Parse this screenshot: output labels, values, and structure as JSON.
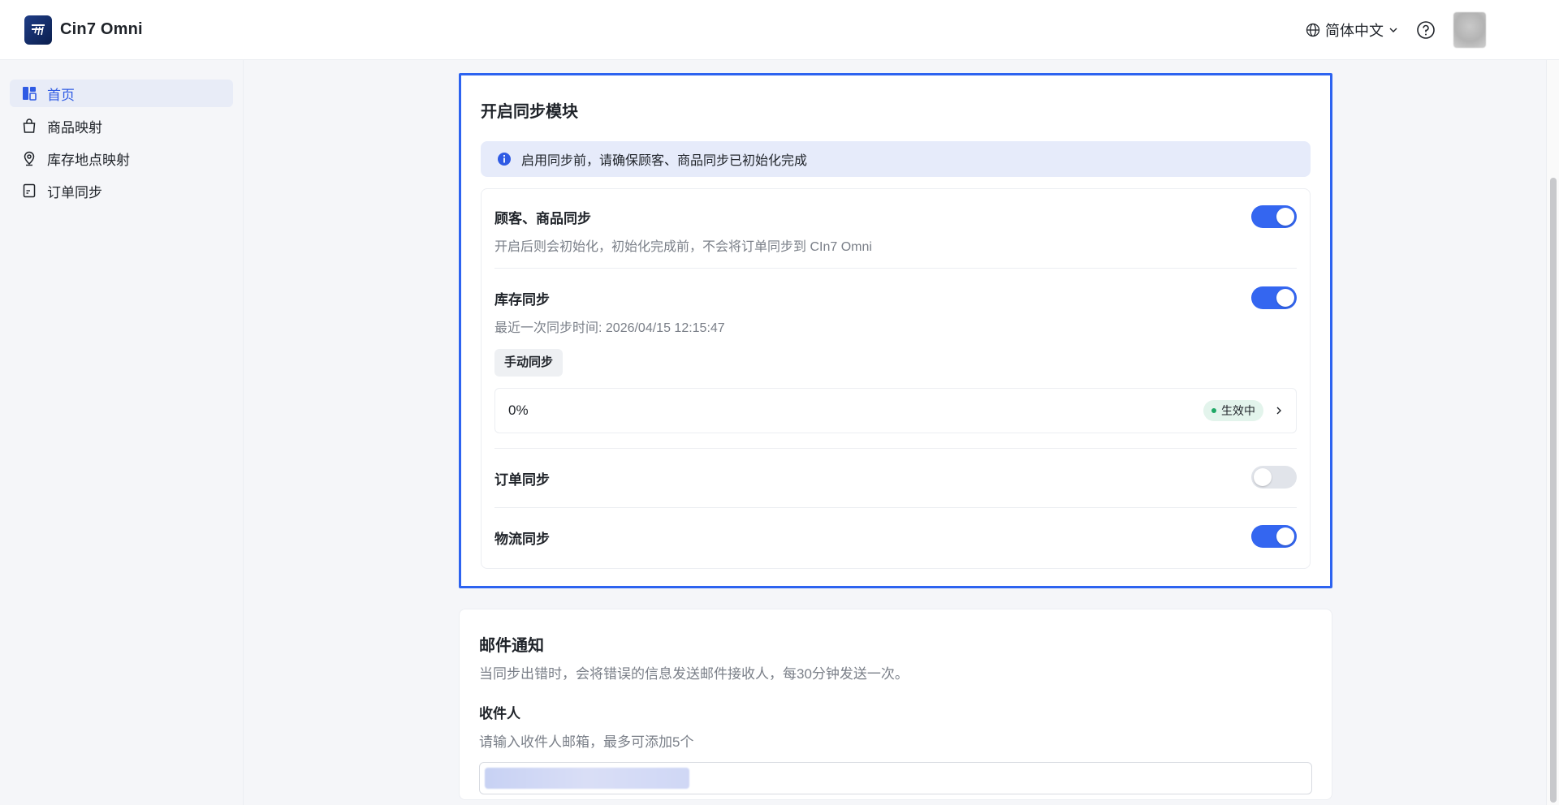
{
  "header": {
    "brand": "Cin7 Omni",
    "language": "简体中文"
  },
  "sidebar": {
    "items": [
      {
        "label": "首页",
        "icon": "dashboard-icon",
        "active": true
      },
      {
        "label": "商品映射",
        "icon": "bag-icon"
      },
      {
        "label": "库存地点映射",
        "icon": "location-icon"
      },
      {
        "label": "订单同步",
        "icon": "document-icon"
      }
    ]
  },
  "sync": {
    "title": "开启同步模块",
    "alert": "启用同步前，请确保顾客、商品同步已初始化完成",
    "customer": {
      "title": "顾客、商品同步",
      "desc": "开启后则会初始化，初始化完成前，不会将订单同步到 CIn7 Omni",
      "enabled": true
    },
    "inventory": {
      "title": "库存同步",
      "desc": "最近一次同步时间: 2026/04/15 12:15:47",
      "enabled": true,
      "manual_button": "手动同步",
      "progress": "0%",
      "status": "生效中"
    },
    "order": {
      "title": "订单同步",
      "enabled": false
    },
    "logistics": {
      "title": "物流同步",
      "enabled": true
    }
  },
  "mail": {
    "title": "邮件通知",
    "desc": "当同步出错时，会将错误的信息发送邮件接收人，每30分钟发送一次。",
    "recipient_label": "收件人",
    "recipient_hint": "请输入收件人邮箱，最多可添加5个"
  },
  "colors": {
    "accent": "#3466f0",
    "highlight_border": "#2d63f0",
    "alert_bg": "#e6ebfa",
    "status_green": "#1fa866"
  }
}
